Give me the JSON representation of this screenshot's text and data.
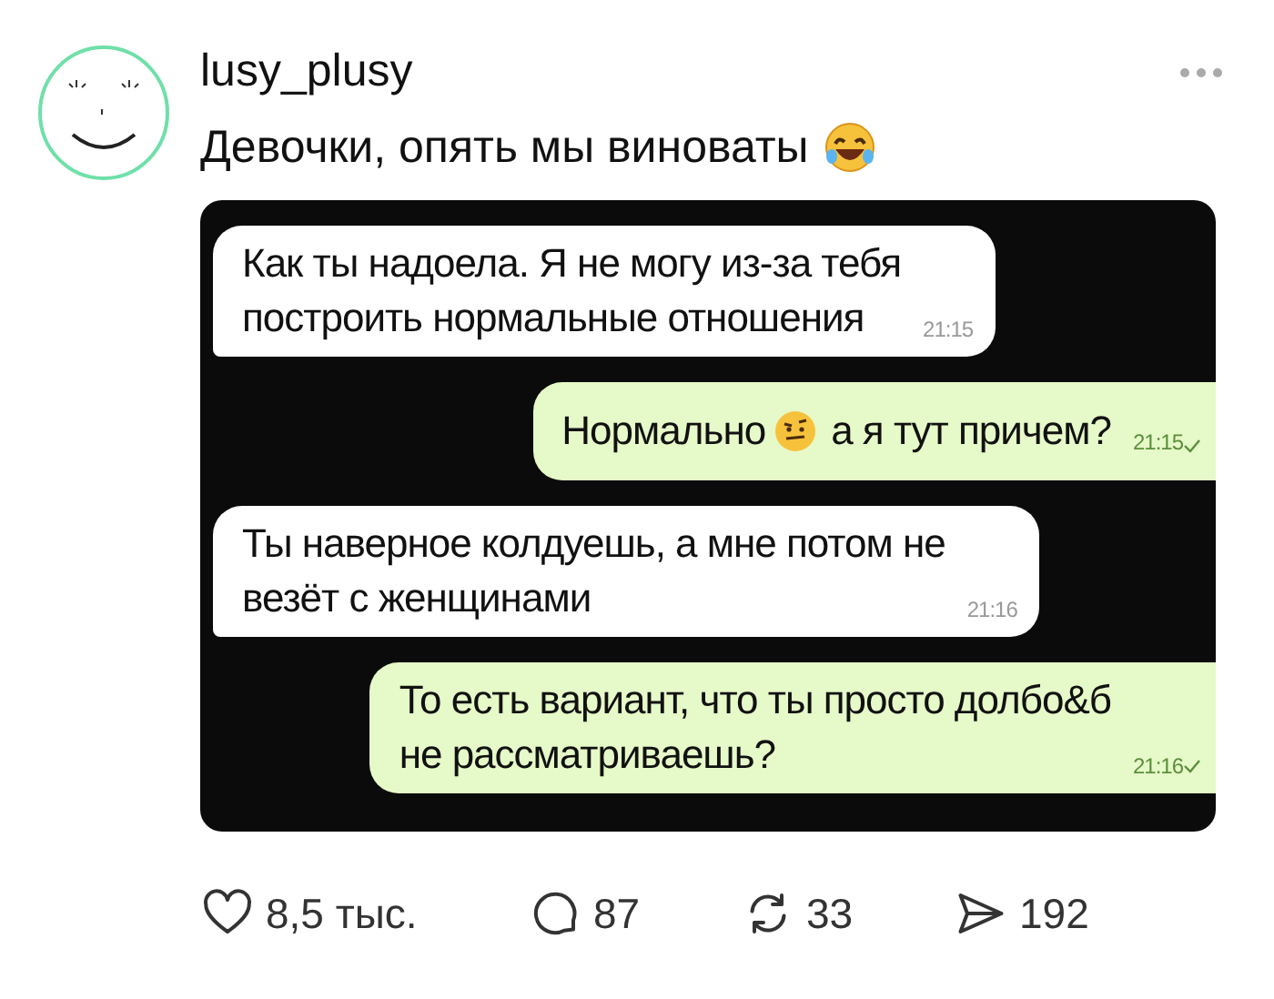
{
  "post": {
    "username": "lusy_plusy",
    "caption": "Девочки, опять мы виноваты"
  },
  "chat": {
    "messages": [
      {
        "kind": "incoming",
        "lines": [
          "Как ты надоела. Я не могу из-за тебя",
          "построить нормальные отношения"
        ],
        "time": "21:15"
      },
      {
        "kind": "outgoing",
        "lines": [
          "Нормально",
          "а я тут причем?"
        ],
        "emoji": true,
        "time": "21:15"
      },
      {
        "kind": "incoming",
        "lines": [
          "Ты наверное колдуешь, а мне потом не",
          "везёт с женщинами"
        ],
        "time": "21:16"
      },
      {
        "kind": "outgoing",
        "lines": [
          "То есть вариант, что ты просто долбо&б",
          "не рассматриваешь?"
        ],
        "time": "21:16"
      }
    ]
  },
  "actions": [
    {
      "kind": "like",
      "count": "8,5 тыс."
    },
    {
      "kind": "comment",
      "count": "87"
    },
    {
      "kind": "repost",
      "count": "33"
    },
    {
      "kind": "share",
      "count": "192"
    }
  ]
}
